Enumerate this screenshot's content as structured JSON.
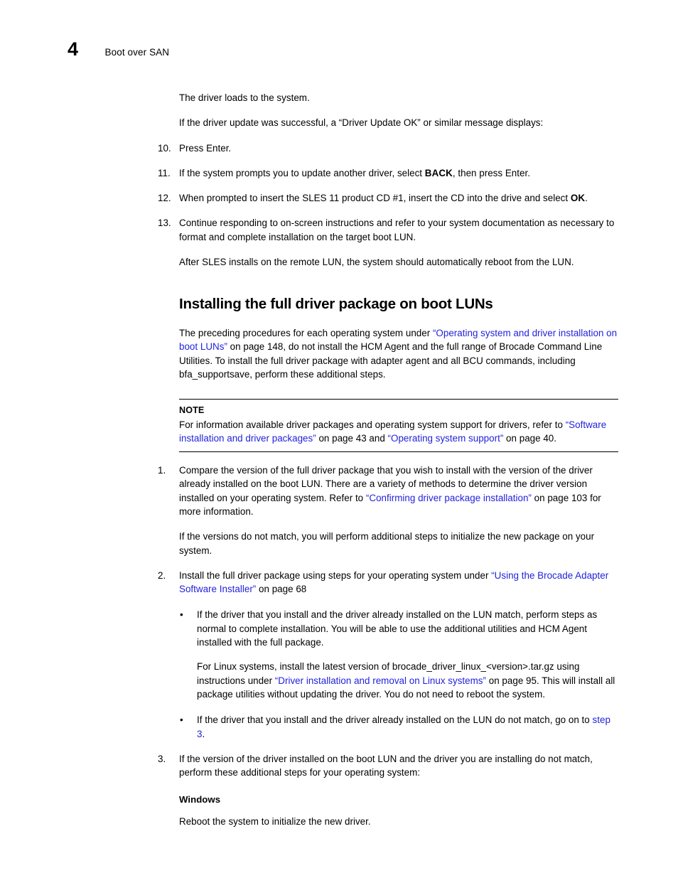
{
  "header": {
    "chapter_number": "4",
    "chapter_title": "Boot over SAN"
  },
  "body": {
    "intro_line_1": "The driver loads to the system.",
    "intro_line_2": "If the driver update was successful, a “Driver Update OK” or similar message displays:",
    "steps_continued": [
      {
        "marker": "10.",
        "text": "Press Enter."
      },
      {
        "marker": "11.",
        "text_before": "If the system prompts you to update another driver, select ",
        "keyword": "BACK",
        "text_after": ", then press Enter."
      },
      {
        "marker": "12.",
        "text_before": "When prompted to insert the SLES 11 product CD #1, insert the CD into the drive and select ",
        "keyword": "OK",
        "text_after": "."
      },
      {
        "marker": "13.",
        "text": "Continue responding to on-screen instructions and refer to your system documentation as necessary to format and complete installation on the target boot LUN."
      }
    ],
    "after_steps_paragraph": "After SLES installs on the remote LUN, the system should automatically reboot from the LUN."
  },
  "section": {
    "heading": "Installing the full driver package on boot LUNs",
    "intro": {
      "part_1": "The preceding procedures for each operating system under ",
      "link_1": "“Operating system and driver installation on boot LUNs”",
      "part_2": " on page 148, do not install the HCM Agent and the full range of Brocade Command Line Utilities. To install the full driver package with adapter agent and all BCU commands, including bfa_supportsave, perform these additional steps."
    }
  },
  "note": {
    "label": "NOTE",
    "part_1": "For information available driver packages and operating system support for drivers, refer to ",
    "link_1": "“Software installation and driver packages”",
    "part_2": " on page 43 and ",
    "link_2": "“Operating system support”",
    "part_3": " on page 40."
  },
  "procedure": {
    "step1": {
      "marker": "1.",
      "part_1": "Compare the version of the full driver package that you wish to install with the version of the driver already installed on the boot LUN. There are a variety of methods to determine the driver version installed on your operating system. Refer to ",
      "link_1": "“Confirming driver package installation”",
      "part_2": " on page 103 for more information.",
      "follow_up": "If the versions do not match, you will perform additional steps to initialize the new package on your system."
    },
    "step2": {
      "marker": "2.",
      "part_1": "Install the full driver package using steps for your operating system under ",
      "link_1": "“Using the Brocade Adapter Software Installer”",
      "part_2": " on page 68",
      "bullets": [
        {
          "glyph": "•",
          "text": "If the driver that you install and the driver already installed on the LUN match, perform steps as normal to complete installation. You will be able to use the additional utilities and HCM Agent installed with the full package.",
          "sub_part_1": "For Linux systems, install the latest version of brocade_driver_linux_<version>.tar.gz using instructions under ",
          "sub_link_1": "“Driver installation and removal on Linux systems”",
          "sub_part_2": " on page 95. This will install all package utilities without updating the driver. You do not need to reboot the system."
        },
        {
          "glyph": "•",
          "part_1": "If the driver that you install and the driver already installed on the LUN do not match, go on to ",
          "link_1": "step 3",
          "part_2": "."
        }
      ]
    },
    "step3": {
      "marker": "3.",
      "text": "If the version of the driver installed on the boot LUN and the driver you are installing do not match, perform these additional steps for your operating system:",
      "os_heading": "Windows",
      "os_body": "Reboot the system to initialize the new driver."
    }
  },
  "colors": {
    "link": "#2222dd",
    "text": "#000000",
    "rule": "#000000"
  }
}
